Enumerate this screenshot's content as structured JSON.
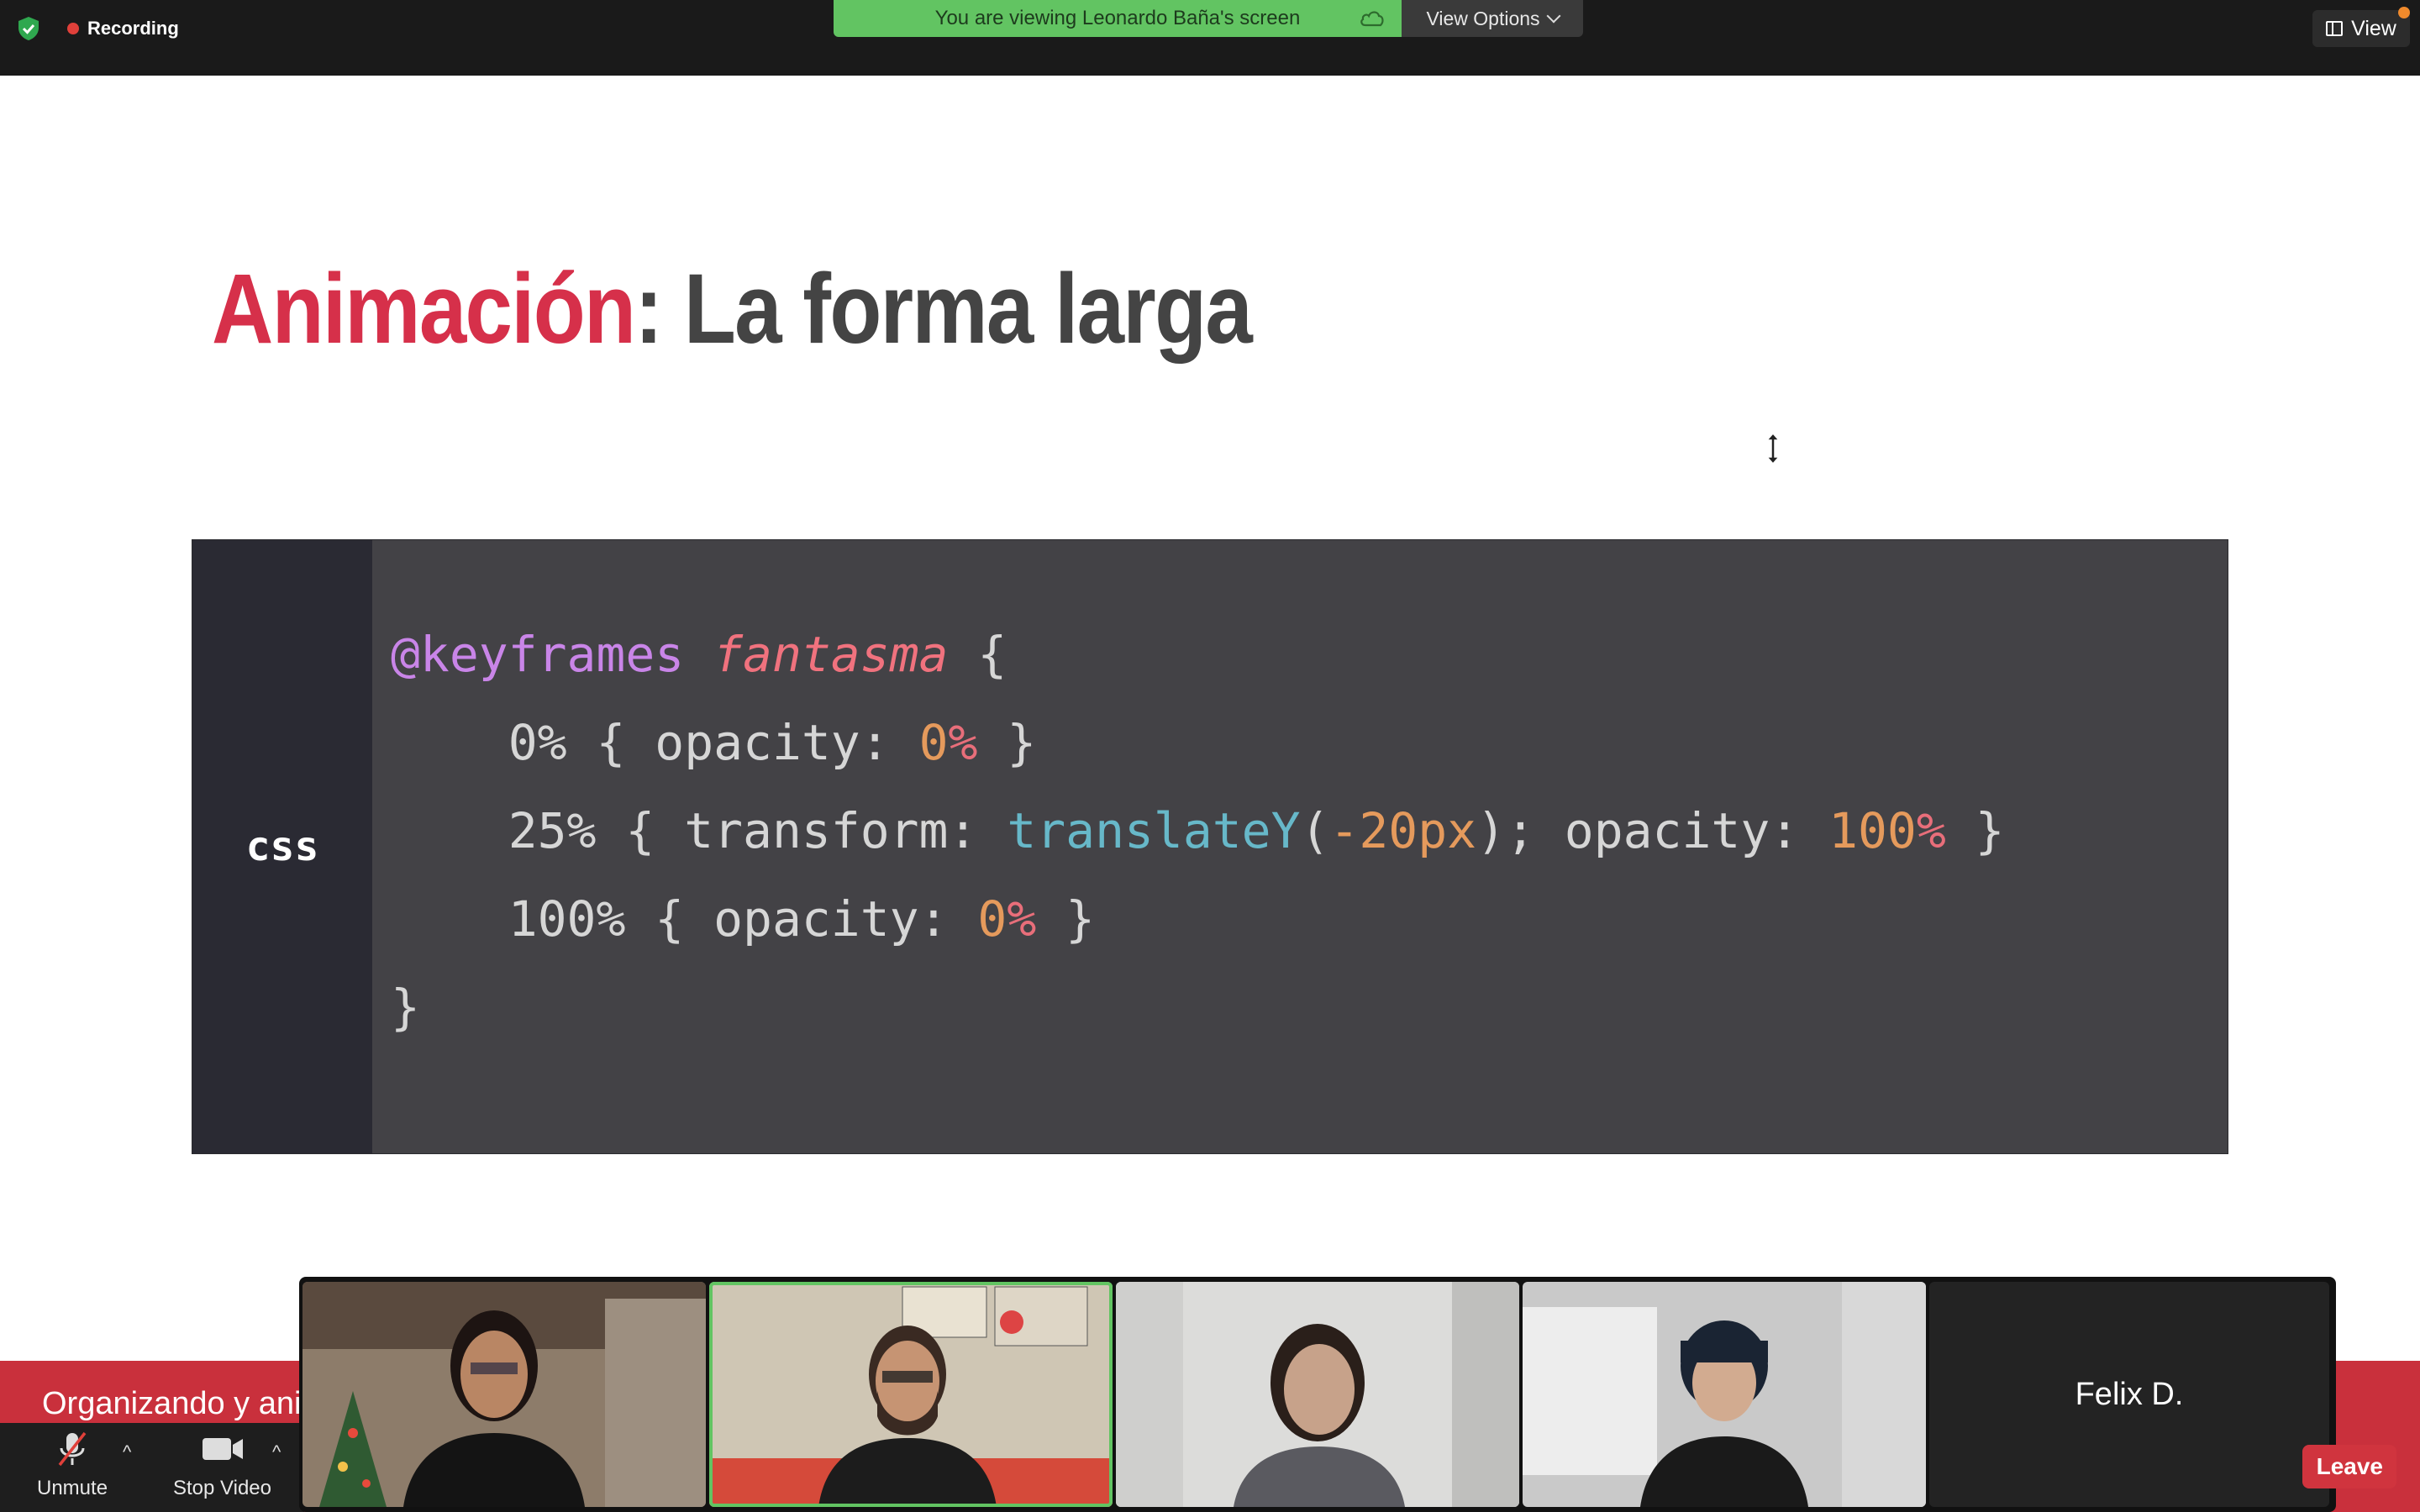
{
  "topbar": {
    "recording_label": "Recording",
    "share_banner": "You are viewing Leonardo Baña's screen",
    "view_options_label": "View Options",
    "view_label": "View"
  },
  "slide": {
    "title_accent": "Animación",
    "title_rest": ": La forma larga",
    "code_language": "css",
    "code_lines": {
      "l1_kw": "@keyframes",
      "l1_name": "fantasma",
      "l1_brace": "{",
      "l2_a": "0% { opacity: ",
      "l2_num": "0",
      "l2_pct": "%",
      "l2_end": " }",
      "l3_a": "25% { transform: ",
      "l3_fn": "translateY",
      "l3_b": "(",
      "l3_num": "-20px",
      "l3_c": "); opacity: ",
      "l3_num2": "100",
      "l3_pct": "%",
      "l3_end": " }",
      "l4_a": "100% { opacity: ",
      "l4_num": "0",
      "l4_pct": "%",
      "l4_end": " }",
      "l5": "}"
    }
  },
  "bottom": {
    "caption": "Organizando y ani",
    "unmute_label": "Unmute",
    "stop_video_label": "Stop Video",
    "leave_label": "Leave",
    "participant_name": "Felix D."
  },
  "colors": {
    "accent_red": "#d6304a",
    "share_green": "#62c462",
    "code_bg": "#434246"
  }
}
